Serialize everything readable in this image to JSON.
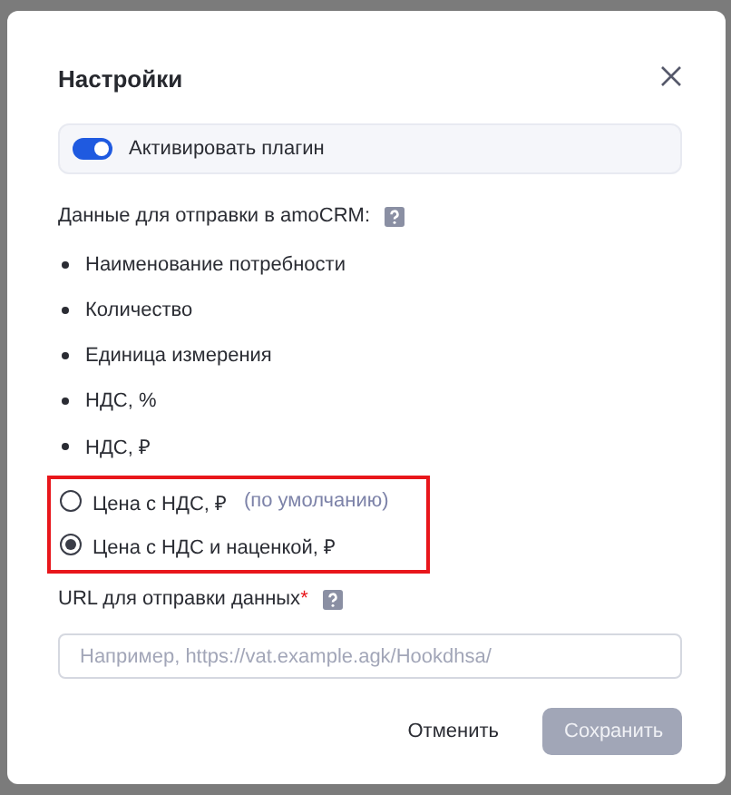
{
  "dialog": {
    "title": "Настройки"
  },
  "toggle": {
    "label": "Активировать плагин",
    "on": true
  },
  "data_section": {
    "label": "Данные для отправки в amoCRM:",
    "items": [
      "Наименование потребности",
      "Количество",
      "Единица измерения",
      "НДС, %",
      "НДС, ₽"
    ]
  },
  "price_options": {
    "highlighted": true,
    "options": [
      {
        "label": "Цена с НДС,  ₽",
        "note": "(по умолчанию)",
        "selected": false
      },
      {
        "label": "Цена с НДС и наценкой, ₽",
        "selected": true
      }
    ]
  },
  "url_field": {
    "label": "URL для отправки данных",
    "required_mark": "*",
    "placeholder": "Например, https://vat.example.agk/Hookdhsa/"
  },
  "buttons": [
    {
      "label": "Отменить",
      "kind": "secondary",
      "disabled": false
    },
    {
      "label": "Сохранить",
      "kind": "primary",
      "disabled": true
    }
  ]
}
